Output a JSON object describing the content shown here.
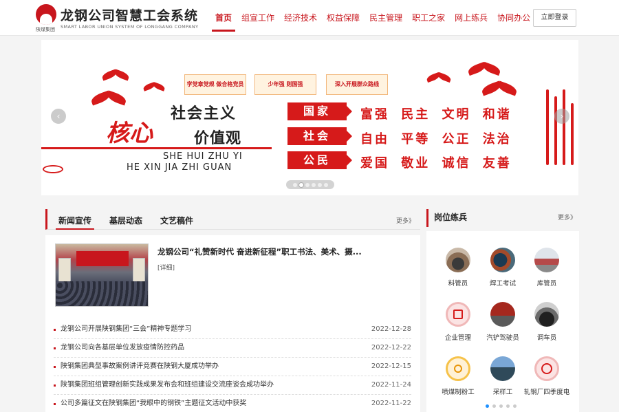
{
  "header": {
    "logo_sub": "陕煤集团",
    "title": "龙钢公司智慧工会系统",
    "subtitle": "SMART LABOR UNION SYSTEM OF LONGGANG COMPANY",
    "login_label": "立即登录"
  },
  "nav": {
    "items": [
      "首页",
      "组宣工作",
      "经济技术",
      "权益保障",
      "民主管理",
      "职工之家",
      "网上练兵",
      "协同办公"
    ],
    "active_index": 0
  },
  "banner": {
    "poster_1": "学党章党规 做合格党员",
    "poster_2": "少年强 则国强",
    "poster_3": "深入开展群众路线",
    "headline_1": "社会主义",
    "core": "核心",
    "headline_2": "价值观",
    "pinyin_1": "SHE HUI ZHU YI",
    "pinyin_2": "HE XIN JIA ZHI GUAN",
    "tags": [
      "国家",
      "社会",
      "公民"
    ],
    "values_row_1": "富强 民主 文明 和谐",
    "values_row_2": "自由 平等 公正 法治",
    "values_row_3": "爱国 敬业 诚信 友善",
    "arrow_left": "‹",
    "arrow_right": "›",
    "slide_count": 6,
    "active_slide": 1
  },
  "news": {
    "tabs": [
      "新闻宣传",
      "基层动态",
      "文艺稿件"
    ],
    "active_tab": 0,
    "more": "更多》",
    "feature_title": "龙钢公司“礼赞新时代 奋进新征程”职工书法、美术、摄...",
    "feature_detail": "[详细]",
    "items": [
      {
        "title": "龙钢公司开展陕钢集团“三会”精神专题学习",
        "date": "2022-12-28"
      },
      {
        "title": "龙钢公司向各基层单位发放疫情防控药品",
        "date": "2022-12-22"
      },
      {
        "title": "陕钢集团典型事故案例讲评竞赛在陕钢大厦成功举办",
        "date": "2022-12-15"
      },
      {
        "title": "陕钢集团班组管理创新实践成果发布会和班组建设交流座谈会成功举办",
        "date": "2022-11-24"
      },
      {
        "title": "公司多篇征文在陕钢集团“我眼中的钢铁”主题征文活动中获奖",
        "date": "2022-11-22"
      }
    ]
  },
  "jobs": {
    "title": "岗位练兵",
    "more": "更多》",
    "items": [
      {
        "label": "料管员",
        "icon": "material-clerk-photo"
      },
      {
        "label": "焊工考试",
        "icon": "welder-photo"
      },
      {
        "label": "库管员",
        "icon": "warehouse-photo"
      },
      {
        "label": "企业管理",
        "icon": "management-icon"
      },
      {
        "label": "汽铲驾驶员",
        "icon": "loader-driver-photo"
      },
      {
        "label": "调车员",
        "icon": "shunter-photo"
      },
      {
        "label": "喷煤制粉工",
        "icon": "coal-powder-icon"
      },
      {
        "label": "采样工",
        "icon": "sampler-photo"
      },
      {
        "label": "轧钢厂四季度电",
        "icon": "rolling-mill-icon"
      }
    ],
    "page_count": 5,
    "active_page": 0
  },
  "colors": {
    "brand_red": "#c8161d",
    "banner_red": "#d61a1a",
    "pager_active": "#1e90ff"
  }
}
